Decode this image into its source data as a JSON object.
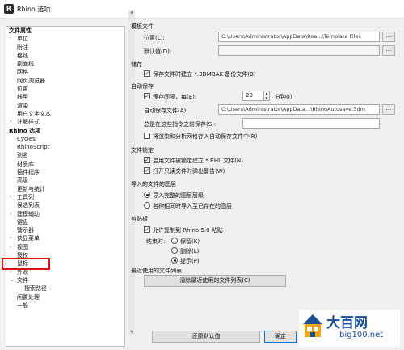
{
  "window": {
    "app_icon": "R",
    "title": "Rhino 选项"
  },
  "tree": {
    "items": [
      {
        "label": "文件属性",
        "level": "root",
        "arrow": ""
      },
      {
        "label": "单位",
        "level": "lvl1",
        "arrow": "›"
      },
      {
        "label": "附注",
        "level": "lvl1",
        "arrow": ""
      },
      {
        "label": "格线",
        "level": "lvl1",
        "arrow": ""
      },
      {
        "label": "剖面线",
        "level": "lvl1",
        "arrow": ""
      },
      {
        "label": "网格",
        "level": "lvl1",
        "arrow": ""
      },
      {
        "label": "网页浏览器",
        "level": "lvl1",
        "arrow": ""
      },
      {
        "label": "位置",
        "level": "lvl1",
        "arrow": ""
      },
      {
        "label": "线型",
        "level": "lvl1",
        "arrow": ""
      },
      {
        "label": "渲染",
        "level": "lvl1",
        "arrow": ""
      },
      {
        "label": "用户文字文本",
        "level": "lvl1",
        "arrow": ""
      },
      {
        "label": "注解样式",
        "level": "lvl1",
        "arrow": "›"
      },
      {
        "label": "Rhino 选项",
        "level": "root",
        "arrow": ""
      },
      {
        "label": "Cycles",
        "level": "lvl1",
        "arrow": ""
      },
      {
        "label": "RhinoScript",
        "level": "lvl1",
        "arrow": ""
      },
      {
        "label": "别名",
        "level": "lvl1",
        "arrow": ""
      },
      {
        "label": "材质库",
        "level": "lvl1",
        "arrow": ""
      },
      {
        "label": "插件程序",
        "level": "lvl1",
        "arrow": ""
      },
      {
        "label": "高级",
        "level": "lvl1",
        "arrow": ""
      },
      {
        "label": "更新与统计",
        "level": "lvl1",
        "arrow": ""
      },
      {
        "label": "工具列",
        "level": "lvl1",
        "arrow": "›"
      },
      {
        "label": "候选列表",
        "level": "lvl1",
        "arrow": ""
      },
      {
        "label": "建模辅助",
        "level": "lvl1",
        "arrow": "›"
      },
      {
        "label": "键盘",
        "level": "lvl1",
        "arrow": ""
      },
      {
        "label": "警示器",
        "level": "lvl1",
        "arrow": ""
      },
      {
        "label": "快显菜单",
        "level": "lvl1",
        "arrow": "›"
      },
      {
        "label": "视图",
        "level": "lvl1",
        "arrow": "›"
      },
      {
        "label": "授权",
        "level": "lvl1",
        "arrow": ""
      },
      {
        "label": "鼠标",
        "level": "lvl1",
        "arrow": ""
      },
      {
        "label": "外观",
        "level": "lvl1",
        "arrow": "›"
      },
      {
        "label": "文件",
        "level": "lvl1",
        "arrow": "⌄"
      },
      {
        "label": "搜索路径",
        "level": "lvl2",
        "arrow": ""
      },
      {
        "label": "闲置处理",
        "level": "lvl1",
        "arrow": ""
      },
      {
        "label": "一般",
        "level": "lvl1",
        "arrow": ""
      }
    ]
  },
  "template": {
    "section": "模板文件",
    "location_label": "位置(L):",
    "location_value": "C:\\Users\\Administrator\\AppData\\Roa...\\Template Files",
    "default_label": "默认值(D):",
    "default_value": "",
    "browse": "..."
  },
  "save": {
    "section": "储存",
    "backup_label": "保存文件时建立 *.3DMBAK 备份文件(B)",
    "backup_checked": "✓"
  },
  "autosave": {
    "section": "自动保存",
    "interval_label": "保存间隔，每(E):",
    "interval_checked": "✓",
    "interval_value": "20",
    "unit": "分钟(I)",
    "file_label": "自动保存文件(A):",
    "file_value": "C:\\Users\\Administrator\\AppData...\\RhinoAutosave.3dm",
    "before_label": "总是在这些指令之前保存(S):",
    "before_value": "",
    "mesh_label": "将渲染和分析网格存入自动保存文件中(R)",
    "mesh_checked": ""
  },
  "locking": {
    "section": "文件锁定",
    "rhl_label": "启用文件被锁定建立 *.RHL 文件(N)",
    "rhl_checked": "✓",
    "readonly_label": "打开只读文件时弹出警告(W)",
    "readonly_checked": "✓"
  },
  "import_layers": {
    "section": "导入的文件的图层",
    "opt1": "导入完整的图层层级",
    "opt2": "名称相同时导入至已存在的图层"
  },
  "clipboard": {
    "section": "剪贴板",
    "allow_label": "允许复制到 Rhino 5.0 粘贴",
    "allow_checked": "✓",
    "on_exit_label": "结束时:",
    "keep": "保留(K)",
    "delete": "删除(L)",
    "prompt": "提示(P)"
  },
  "recent": {
    "section": "最近使用的文件列表",
    "clear_button": "清除最近使用的文件列表(C)"
  },
  "footer": {
    "restore_button": "还原默认值",
    "ok_button": "确定"
  },
  "watermark": {
    "big": "大百网",
    "small": "big100.net"
  },
  "colors": {
    "highlight": "#e01010",
    "brand": "#1c4f95"
  }
}
